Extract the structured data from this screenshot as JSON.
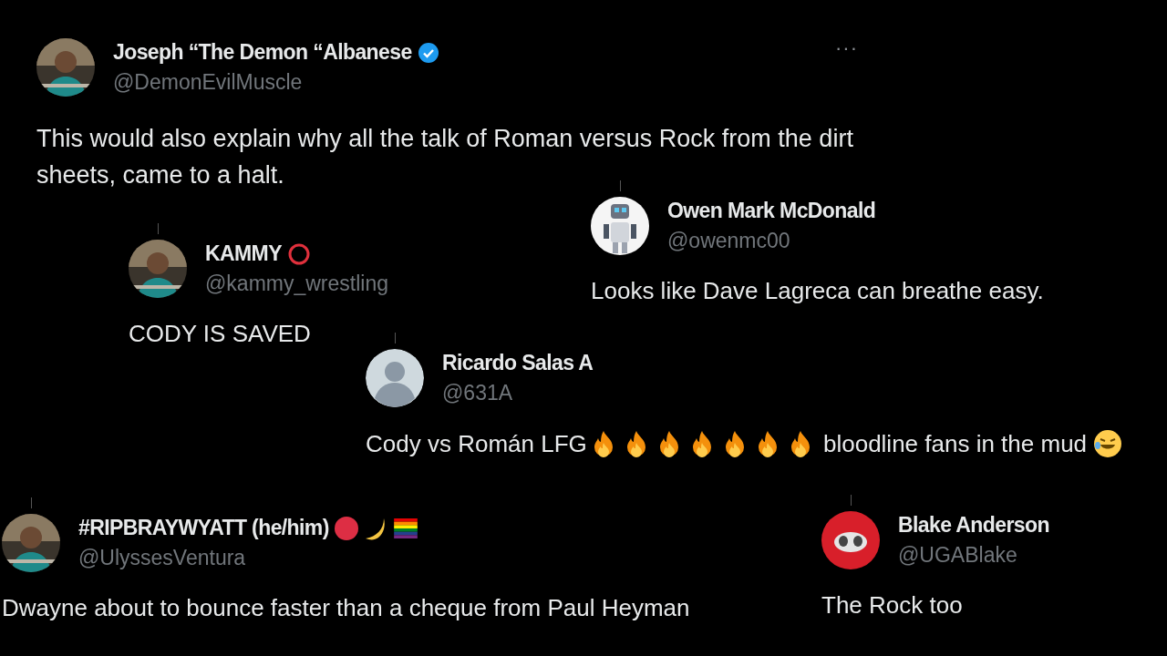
{
  "main_post": {
    "author": {
      "name": "Joseph “The Demon “Albanese",
      "handle": "@DemonEvilMuscle",
      "verified": true
    },
    "more": "···",
    "body": "This would also explain why all the talk of Roman versus Rock from the dirt sheets, came to a halt."
  },
  "replies": [
    {
      "author": {
        "name": "KAMMY",
        "handle": "@kammy_wrestling",
        "badges": [
          {
            "kind": "ring"
          }
        ]
      },
      "body": [
        {
          "kind": "text",
          "text": "CODY IS SAVED"
        }
      ]
    },
    {
      "author": {
        "name": "Owen Mark McDonald",
        "handle": "@owenmc00"
      },
      "body": [
        {
          "kind": "text",
          "text": "Looks like Dave Lagreca can breathe easy."
        }
      ]
    },
    {
      "author": {
        "name": "Ricardo Salas A",
        "handle": "@631A"
      },
      "body": [
        {
          "kind": "text",
          "text": "Cody vs Román LFG"
        },
        {
          "kind": "fire"
        },
        {
          "kind": "fire"
        },
        {
          "kind": "fire"
        },
        {
          "kind": "fire"
        },
        {
          "kind": "fire"
        },
        {
          "kind": "fire"
        },
        {
          "kind": "fire"
        },
        {
          "kind": "text",
          "text": " bloodline fans in the mud "
        },
        {
          "kind": "laugh"
        }
      ]
    },
    {
      "author": {
        "name": "#RIPBRAYWYATT (he/him)",
        "handle": "@UlyssesVentura",
        "badges": [
          {
            "kind": "dot"
          },
          {
            "kind": "moon"
          },
          {
            "kind": "rainbow-flag"
          }
        ]
      },
      "body": [
        {
          "kind": "text",
          "text": "Dwayne about to bounce faster than a cheque from Paul Heyman"
        }
      ]
    },
    {
      "author": {
        "name": "Blake Anderson",
        "handle": "@UGABlake"
      },
      "body": [
        {
          "kind": "text",
          "text": "The Rock too"
        }
      ]
    }
  ]
}
